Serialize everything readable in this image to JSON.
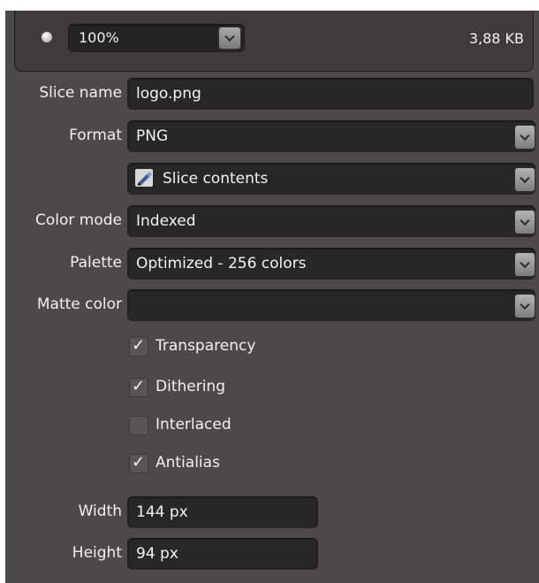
{
  "preview": {
    "zoom": "100%",
    "file_size": "3,88 KB"
  },
  "fields": {
    "slice_name": {
      "label": "Slice name",
      "value": "logo.png"
    },
    "format": {
      "label": "Format",
      "value": "PNG"
    },
    "slice_contents": {
      "value": "Slice contents"
    },
    "color_mode": {
      "label": "Color mode",
      "value": "Indexed"
    },
    "palette": {
      "label": "Palette",
      "value": "Optimized - 256 colors"
    },
    "matte_color": {
      "label": "Matte color",
      "value": ""
    }
  },
  "checkboxes": [
    {
      "label": "Transparency",
      "checked": true
    },
    {
      "label": "Dithering",
      "checked": true
    },
    {
      "label": "Interlaced",
      "checked": false
    },
    {
      "label": "Antialias",
      "checked": true
    }
  ],
  "dimensions": {
    "width": {
      "label": "Width",
      "value": "144 px"
    },
    "height": {
      "label": "Height",
      "value": "94 px"
    }
  },
  "check_glyph": "✓",
  "colors": {
    "panel_bg": "#4b4a47",
    "field_bg": "#272726"
  },
  "icons": {
    "zoom_dropdown": "chevron-down-icon",
    "slice_contents": "slice-brush-icon"
  }
}
